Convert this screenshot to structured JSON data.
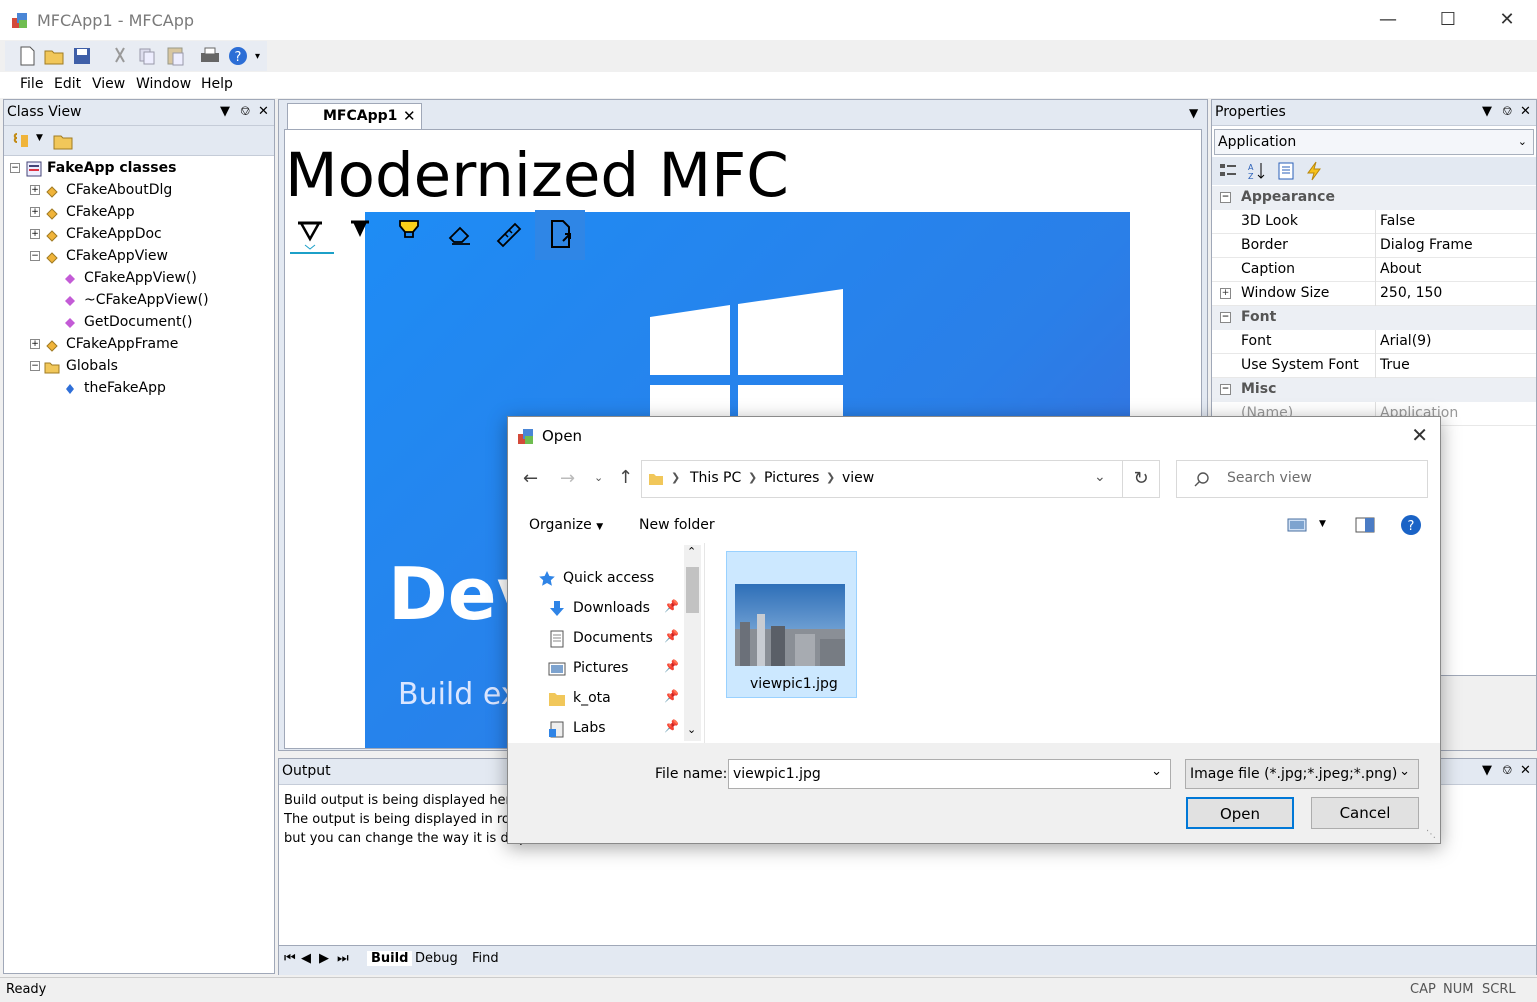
{
  "window": {
    "title": "MFCApp1 - MFCApp"
  },
  "menu": [
    "File",
    "Edit",
    "View",
    "Window",
    "Help"
  ],
  "class_view": {
    "title": "Class View",
    "tree": [
      {
        "label": "FakeApp classes",
        "bold": true
      },
      {
        "label": "CFakeAboutDlg"
      },
      {
        "label": "CFakeApp"
      },
      {
        "label": "CFakeAppDoc"
      },
      {
        "label": "CFakeAppView"
      },
      {
        "label": "CFakeAppView()"
      },
      {
        "label": "~CFakeAppView()"
      },
      {
        "label": "GetDocument()"
      },
      {
        "label": "CFakeAppFrame"
      },
      {
        "label": "Globals"
      },
      {
        "label": "theFakeApp"
      }
    ]
  },
  "document": {
    "tab_label": "MFCApp1",
    "heading": "Modernized MFC",
    "hero_dev": "Dev",
    "hero_build": "Build exp"
  },
  "properties": {
    "title": "Properties",
    "object": "Application",
    "categories": [
      {
        "name": "Appearance",
        "rows": [
          {
            "name": "3D Look",
            "value": "False"
          },
          {
            "name": "Border",
            "value": "Dialog Frame"
          },
          {
            "name": "Caption",
            "value": "About"
          },
          {
            "name": "Window Size",
            "value": "250, 150"
          }
        ]
      },
      {
        "name": "Font",
        "rows": [
          {
            "name": "Font",
            "value": "Arial(9)"
          },
          {
            "name": "Use System Font",
            "value": "True"
          }
        ]
      },
      {
        "name": "Misc",
        "rows": [
          {
            "name": "(Name)",
            "value": "Application"
          }
        ]
      }
    ]
  },
  "output": {
    "title": "Output",
    "lines": [
      "Build output is being displayed here.",
      "The output is being displayed in rows",
      "but you can change the way it is disp"
    ],
    "tabs": [
      "Build",
      "Debug",
      "Find"
    ]
  },
  "status": {
    "text": "Ready",
    "indicators": [
      "CAP",
      "NUM",
      "SCRL"
    ]
  },
  "dialog": {
    "title": "Open",
    "path": [
      "This PC",
      "Pictures",
      "view"
    ],
    "search_placeholder": "Search view",
    "organize": "Organize",
    "new_folder": "New folder",
    "nav": [
      {
        "label": "Quick access",
        "icon": "star-icon"
      },
      {
        "label": "Downloads",
        "icon": "download-icon"
      },
      {
        "label": "Documents",
        "icon": "documents-icon"
      },
      {
        "label": "Pictures",
        "icon": "pictures-icon"
      },
      {
        "label": "k_ota",
        "icon": "folder-icon"
      },
      {
        "label": "Labs",
        "icon": "labs-icon"
      }
    ],
    "file": {
      "name": "viewpic1.jpg"
    },
    "file_name_label": "File name:",
    "file_name_value": "viewpic1.jpg",
    "file_type": "Image file (*.jpg;*.jpeg;*.png)",
    "open_label": "Open",
    "cancel_label": "Cancel"
  }
}
